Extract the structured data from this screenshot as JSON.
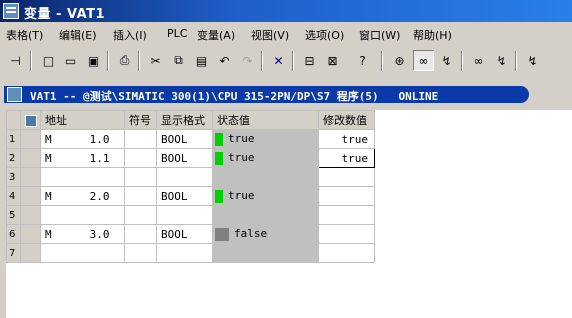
{
  "window": {
    "title": "变量 - VAT1"
  },
  "menu": [
    "表格(T)",
    "编辑(E)",
    "插入(I)",
    "PLC",
    "变量(A)",
    "视图(V)",
    "选项(O)",
    "窗口(W)",
    "帮助(H)"
  ],
  "toolbar": {
    "icons": [
      "pin-icon",
      "new-icon",
      "open-icon",
      "save-icon",
      "print-icon",
      "cut-icon",
      "copy-icon",
      "paste-icon",
      "undo-icon",
      "redo-icon",
      "delete-icon",
      "network-icon",
      "accessible-node-icon",
      "help-icon",
      "monitor-icon",
      "monitor-glasses-icon",
      "modify-icon",
      "monitor-trigger-icon",
      "modify-trigger-icon",
      "force-icon"
    ]
  },
  "vat": {
    "title": "VAT1 -- @测试\\SIMATIC 300(1)\\CPU 315-2PN/DP\\S7 程序(5)   ONLINE",
    "columns": {
      "address": "地址",
      "symbol": "符号",
      "format": "显示格式",
      "status": "状态值",
      "modify": "修改数值"
    },
    "rows": [
      {
        "num": "1",
        "area": "M",
        "addr": "1.0",
        "format": "BOOL",
        "status": "true",
        "led": "#00d000",
        "modify": "true"
      },
      {
        "num": "2",
        "area": "M",
        "addr": "1.1",
        "format": "BOOL",
        "status": "true",
        "led": "#00d000",
        "modify": "true"
      },
      {
        "num": "3",
        "area": "",
        "addr": "",
        "format": "",
        "status": "",
        "led": "",
        "modify": ""
      },
      {
        "num": "4",
        "area": "M",
        "addr": "2.0",
        "format": "BOOL",
        "status": "true",
        "led": "#00d000",
        "modify": ""
      },
      {
        "num": "5",
        "area": "",
        "addr": "",
        "format": "",
        "status": "",
        "led": "",
        "modify": ""
      },
      {
        "num": "6",
        "area": "M",
        "addr": "3.0",
        "format": "BOOL",
        "status": "false",
        "led": "#808080",
        "modify": ""
      },
      {
        "num": "7",
        "area": "",
        "addr": "",
        "format": "",
        "status": "",
        "led": "",
        "modify": ""
      }
    ]
  }
}
